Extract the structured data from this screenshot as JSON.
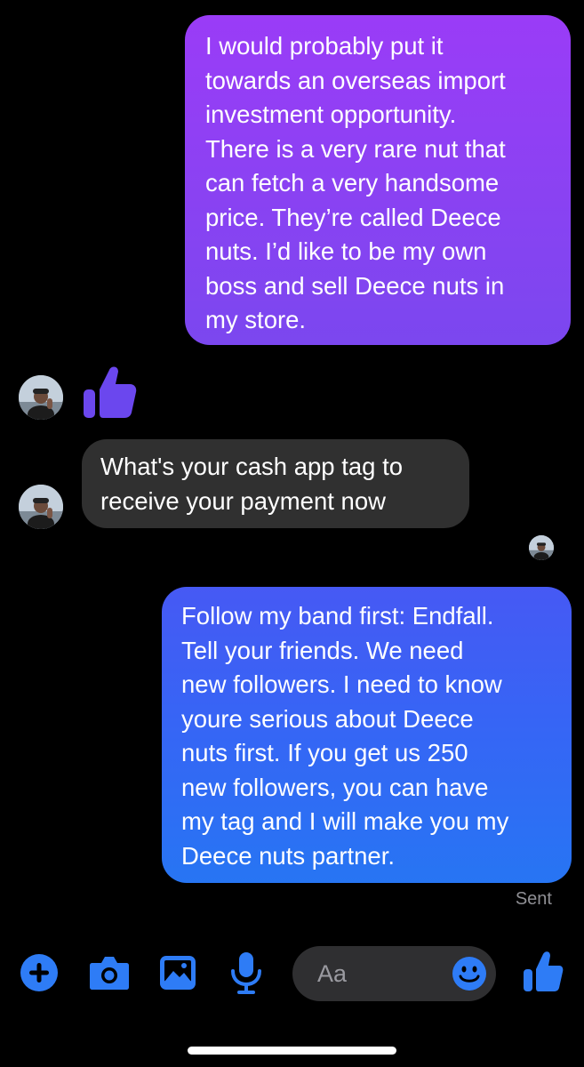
{
  "conversation": {
    "messages": [
      {
        "direction": "sent",
        "lines": [
          "I would probably put it",
          "towards an overseas import",
          "investment opportunity.",
          "There is a very rare nut that",
          "can fetch a very handsome",
          "price. They’re called Deece",
          "nuts. I’d like to be my own",
          "boss and sell Deece nuts in",
          "my store."
        ]
      },
      {
        "direction": "received",
        "lines": [
          "What's your cash app tag to",
          "receive your payment now"
        ]
      },
      {
        "direction": "sent",
        "lines": [
          "Follow my band first: Endfall.",
          "Tell your friends. We need",
          "new followers. I need to know",
          "youre serious about Deece",
          "nuts first. If you get us 250",
          "new followers, you can have",
          "my tag and I will make you my",
          "Deece nuts partner."
        ]
      }
    ],
    "status": "Sent"
  },
  "composer": {
    "placeholder": "Aa",
    "icons": [
      "plus-icon",
      "camera-icon",
      "gallery-icon",
      "microphone-icon",
      "emoji-icon",
      "thumbs-up-icon"
    ]
  },
  "colors": {
    "background": "#000000",
    "sent_bubble_top": "#9a3cf7",
    "sent_bubble_bottom": "#2775f3",
    "received_bubble": "#303030",
    "accent": "#2e7cf6",
    "reaction": "#6b47ee"
  }
}
